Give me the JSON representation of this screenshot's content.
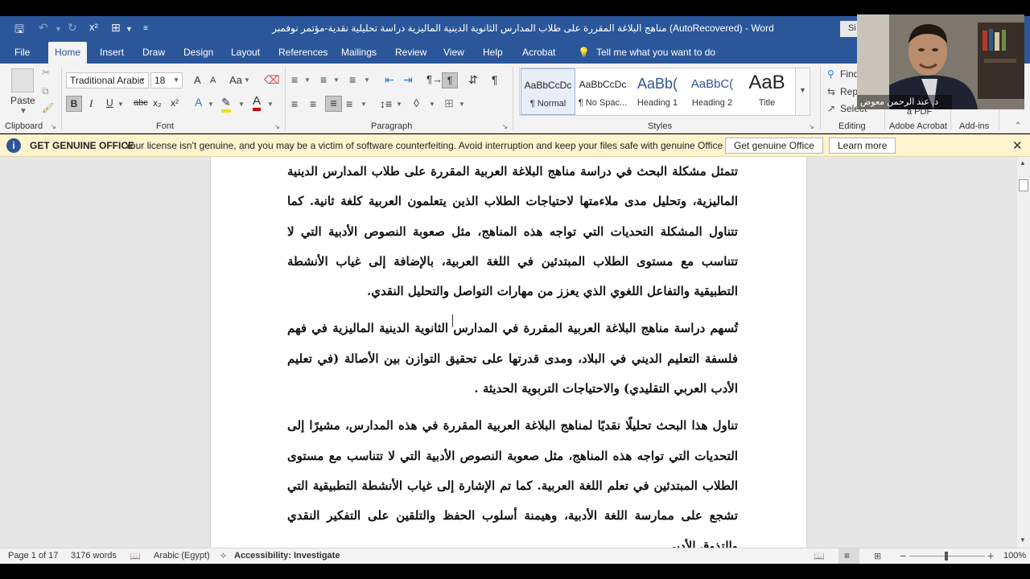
{
  "title_bar": {
    "document_title": "مناهج البلاغة المقررة على طلاب المدارس الثانوية الدينية الماليزية دراسة تحليلية نقدية-مؤتمر نوفمبر (AutoRecovered)  -  Word",
    "sign_in_label": "Si"
  },
  "tabs": [
    "File",
    "Home",
    "Insert",
    "Draw",
    "Design",
    "Layout",
    "References",
    "Mailings",
    "Review",
    "View",
    "Help",
    "Acrobat"
  ],
  "tell_me": "Tell me what you want to do",
  "ribbon": {
    "clipboard": {
      "paste_label": "Paste",
      "group_label": "Clipboard"
    },
    "font": {
      "font_name": "Traditional Arabic",
      "font_size": "18",
      "group_label": "Font",
      "bold": "B",
      "italic": "I",
      "underline": "U",
      "strike": "abc",
      "subscript": "x₂",
      "superscript": "x²",
      "change_case": "Aa",
      "grow": "A",
      "shrink": "A"
    },
    "paragraph": {
      "group_label": "Paragraph"
    },
    "styles": {
      "group_label": "Styles",
      "items": [
        {
          "preview": "AaBbCcDc",
          "name": "¶ Normal"
        },
        {
          "preview": "AaBbCcDc",
          "name": "¶ No Spac..."
        },
        {
          "preview": "AaBb(",
          "name": "Heading 1"
        },
        {
          "preview": "AaBbC(",
          "name": "Heading 2"
        },
        {
          "preview": "AaB",
          "name": "Title"
        }
      ]
    },
    "editing": {
      "find": "Find",
      "replace": "Rep",
      "select": "Select",
      "group_label": "Editing"
    },
    "acrobat": {
      "pdf_label": "a PDF",
      "group_label": "Adobe Acrobat"
    },
    "addins": {
      "group_label": "Add-ins"
    }
  },
  "notice": {
    "title": "GET GENUINE OFFICE",
    "message": "Your license isn't genuine, and you may be a victim of software counterfeiting. Avoid interruption and keep your files safe with genuine Office today.",
    "primary_button": "Get genuine Office",
    "secondary_button": "Learn more"
  },
  "document": {
    "paragraphs": [
      "تتمثل مشكلة البحث في دراسة مناهج البلاغة العربية المقررة على طلاب المدارس الدينية الماليزية، وتحليل مدى ملاءمتها لاحتياجات الطلاب الذين يتعلمون العربية كلغة ثانية. كما تتناول المشكلة التحديات التي تواجه هذه المناهج، مثل صعوبة النصوص الأدبية التي لا تتناسب مع مستوى الطلاب المبتدئين في اللغة العربية، بالإضافة إلى غياب الأنشطة التطبيقية والتفاعل اللغوي الذي يعزز من مهارات التواصل والتحليل النقدي.",
      "تُسهم دراسة مناهج البلاغة العربية المقررة في المدارس الثانوية الدينية الماليزية في فهم فلسفة التعليم الديني في البلاد، ومدى قدرتها على تحقيق التوازن بين الأصالة (في تعليم الأدب العربي التقليدي) والاحتياجات التربوية الحديثة .",
      "تناول هذا البحث تحليلًا نقديًا لمناهج البلاغة العربية المقررة في هذه المدارس، مشيرًا إلى التحديات التي تواجه هذه المناهج، مثل صعوبة النصوص الأدبية التي لا تتناسب مع مستوى الطلاب المبتدئين في تعلم اللغة العربية. كما تم الإشارة إلى غياب الأنشطة التطبيقية التي تشجع على ممارسة اللغة الأدبية، وهيمنة أسلوب الحفظ والتلقين على التفكير النقدي والتذوق الأدبي."
    ]
  },
  "status": {
    "page": "Page 1 of 17",
    "words": "3176 words",
    "language": "Arabic (Egypt)",
    "accessibility": "Accessibility: Investigate",
    "zoom": "100%"
  },
  "webcam": {
    "name": "د. عبد الرحمن معوض"
  },
  "colors": {
    "accent": "#2b579a",
    "notice_bg": "#fff4ce",
    "ribbon_bg": "#f3f3f3"
  }
}
